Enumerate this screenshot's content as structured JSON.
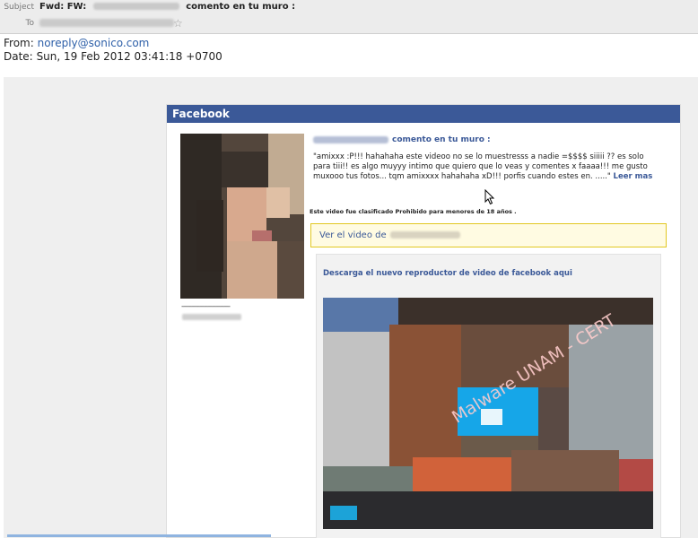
{
  "header": {
    "subject_label": "Subject",
    "subject_prefix": "Fwd: FW:",
    "subject_suffix": "comento en tu muro :",
    "to_label": "To",
    "star_icon": "star-outline-icon"
  },
  "meta": {
    "from_label": "From:",
    "from_email": "noreply@sonico.com",
    "date_label": "Date:",
    "date_value": "Sun, 19 Feb 2012 03:41:18 +0700"
  },
  "fb": {
    "bar_title": "Facebook",
    "dashes": "------------------------",
    "headline_suffix": "comento en tu muro :",
    "message": "\"amixxx :P!!! hahahaha este videoo no se lo muestresss a nadie =$$$$ siiiii ?? es solo para tiii!! es algo muyyy intimo que quiero que lo veas y comentes x faaaa!!! me gusto muxooo tus fotos... tqm amixxxx hahahaha xD!!! porfis cuando estes en. .....\"",
    "read_more": "Leer mas",
    "rating": "Este video fue clasificado Prohibido para menores de 18 años .",
    "video_link": "Ver el video de",
    "download_title": "Descarga el nuevo reproductor de video de facebook aqui",
    "watermark": "Malware UNAM - CERT"
  },
  "colors": {
    "facebook_blue": "#3b5998",
    "link_blue": "#2d5fa8",
    "highlight_yellow": "#fffbe2",
    "highlight_border": "#e2c822"
  }
}
